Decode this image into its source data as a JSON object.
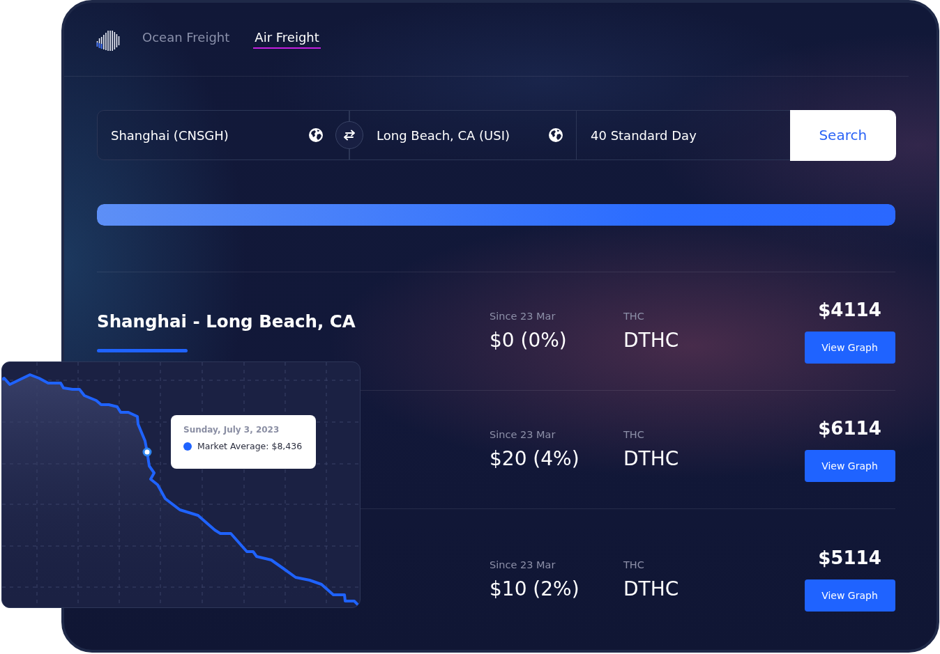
{
  "header": {
    "tabs": [
      {
        "label": "Ocean Freight",
        "selected": false
      },
      {
        "label": "Air Freight",
        "selected": true
      }
    ]
  },
  "search": {
    "origin": "Shanghai (CNSGH)",
    "destination": "Long Beach, CA (USI)",
    "service": "40 Standard Day",
    "button": "Search"
  },
  "progress": {
    "level": 1
  },
  "results": [
    {
      "title": "Shanghai - Long Beach, CA",
      "change_label": "Since 23 Mar",
      "change": "$0 (0%)",
      "charge_label": "THC",
      "charge": "DTHC",
      "price": "$4114",
      "button": "View Graph"
    },
    {
      "change_label": "Since 23 Mar",
      "change": "$20 (4%)",
      "charge_label": "THC",
      "charge": "DTHC",
      "price": "$6114",
      "button": "View Graph"
    },
    {
      "change_label": "Since 23 Mar",
      "change": "$10 (2%)",
      "charge_label": "THC",
      "charge": "DTHC",
      "price": "$5114",
      "button": "View Graph"
    }
  ],
  "chart_popup": {
    "tooltip": {
      "date": "Sunday, July 3, 2023",
      "value": "Market Average: $8,436"
    }
  }
}
